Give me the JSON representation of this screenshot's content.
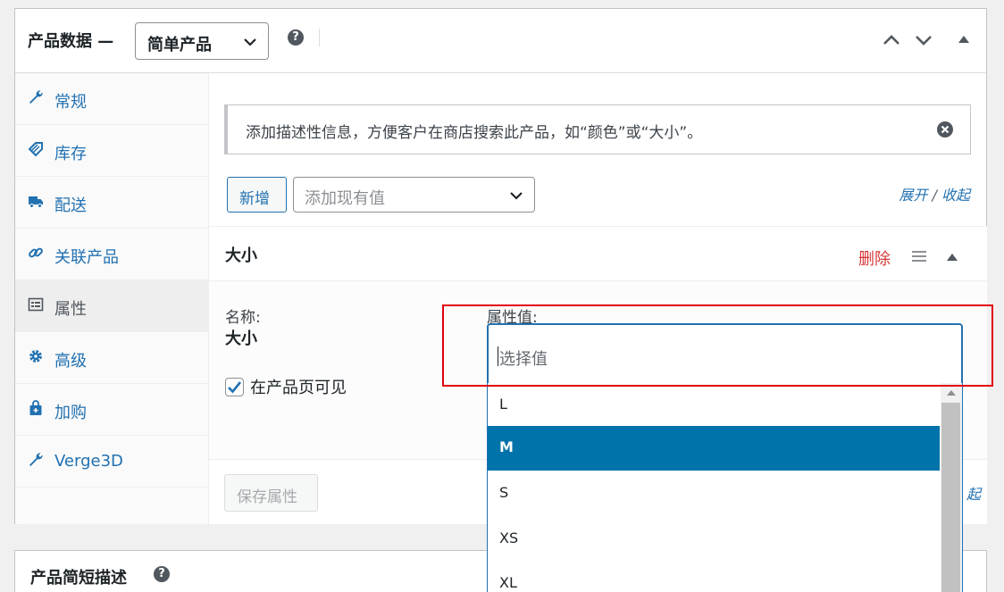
{
  "header": {
    "title": "产品数据 —",
    "product_type": "简单产品"
  },
  "sidebar": {
    "items": [
      {
        "label": "常规",
        "icon": "wrench-icon"
      },
      {
        "label": "库存",
        "icon": "tag-icon"
      },
      {
        "label": "配送",
        "icon": "truck-icon"
      },
      {
        "label": "关联产品",
        "icon": "link-icon"
      },
      {
        "label": "属性",
        "icon": "list-icon"
      },
      {
        "label": "高级",
        "icon": "gear-icon"
      },
      {
        "label": "加购",
        "icon": "bag-icon"
      },
      {
        "label": "Verge3D",
        "icon": "wrench-icon"
      }
    ],
    "active_index": 4
  },
  "notice": {
    "text": "添加描述性信息，方便客户在商店搜索此产品，如“颜色”或“大小”。"
  },
  "toolbar": {
    "add_label": "新增",
    "existing_placeholder": "添加现有值",
    "expand_label": "展开",
    "separator": " / ",
    "collapse_label": "收起"
  },
  "attribute": {
    "name": "大小",
    "delete_label": "删除",
    "name_label": "名称:",
    "name_value": "大小",
    "values_label": "属性值:",
    "visible_label": "在产品页可见",
    "visible_checked": true
  },
  "footer": {
    "save_label": "保存属性",
    "link_fragment": "起"
  },
  "value_picker": {
    "placeholder": "选择值",
    "options": [
      "L",
      "M",
      "S",
      "XS",
      "XL"
    ],
    "highlighted": "M"
  },
  "short_desc": {
    "title": "产品简短描述"
  },
  "colors": {
    "link": "#2271b1",
    "highlight": "#0073aa",
    "delete": "#d63638",
    "annotation": "#e3000f"
  }
}
